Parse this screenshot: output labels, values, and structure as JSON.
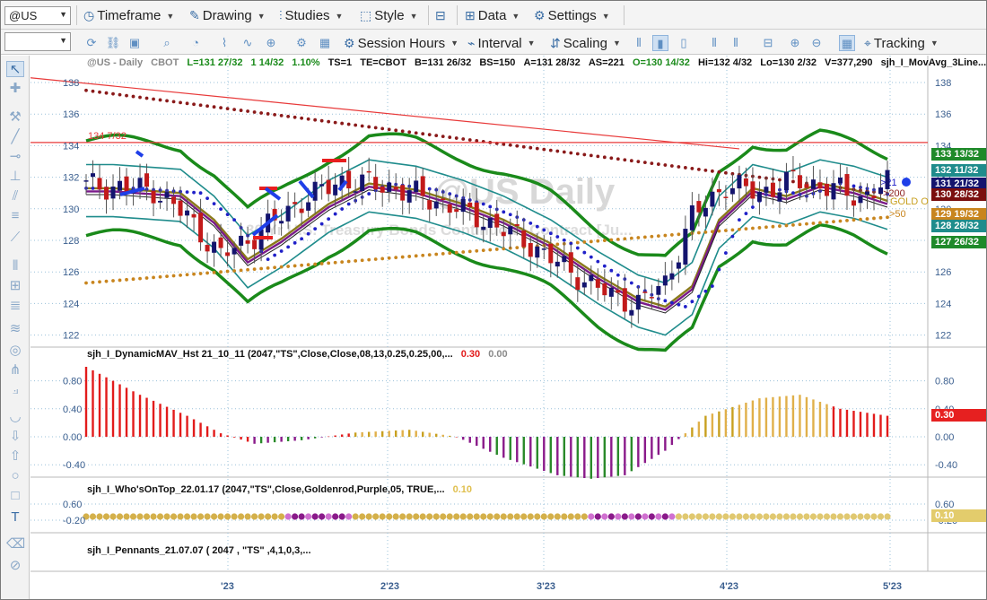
{
  "toolbar_top": {
    "symbol": "@US",
    "timeframe": "Timeframe",
    "drawing": "Drawing",
    "studies": "Studies",
    "style": "Style",
    "data": "Data",
    "settings": "Settings"
  },
  "toolbar_second": {
    "session_hours": "Session Hours",
    "interval": "Interval",
    "scaling": "Scaling",
    "tracking": "Tracking"
  },
  "price_header": {
    "symbol_label": "@US - Daily",
    "exchange": "CBOT",
    "last": "L=131 27/32",
    "change": "1 14/32",
    "pct": "1.10%",
    "ts": "TS=1",
    "te": "TE=CBOT",
    "bid": "B=131 26/32",
    "bs": "BS=150",
    "ask": "A=131 28/32",
    "as": "AS=221",
    "open": "O=130 14/32",
    "high": "Hi=132 4/32",
    "low": "Lo=130 2/32",
    "volume": "V=377,290",
    "study": "sjh_I_MovAvg_3Line..."
  },
  "watermark": {
    "main": "@US Daily",
    "sub": "30 Yr U.S. Treasury Bonds Continuous Contract [Ju..."
  },
  "horizontal_line_label": "134 7/32",
  "price_axis": [
    "138",
    "136",
    "134",
    "132",
    "130",
    "128",
    "126",
    "124",
    "122"
  ],
  "price_tags": [
    {
      "text": "133 13/32",
      "color": "#1f8a2a"
    },
    {
      "text": "132 11/32",
      "color": "#1f8c8c"
    },
    {
      "text": "131 21/32",
      "color": "#14146e"
    },
    {
      "text": "130 28/32",
      "color": "#7a0f0f"
    },
    {
      "text": "129 19/32",
      "color": "#c8851e"
    },
    {
      "text": "128 28/32",
      "color": "#1f8c8c"
    },
    {
      "text": "127 26/32",
      "color": "#1f8a2a"
    }
  ],
  "ma_labels": {
    "l21": ">21",
    "l200": ">200",
    "gold": "GOLD O",
    "l50": ">50"
  },
  "subpanel1": {
    "title": "sjh_I_DynamicMAV_Hst 21_10_11 (2047,\"TS\",Close,Close,08,13,0.25,0.25,00,...",
    "v1": "0.30",
    "v2": "0.00",
    "axis": [
      "0.80",
      "0.40",
      "0.00",
      "-0.40"
    ],
    "tag": "0.30"
  },
  "subpanel2": {
    "title": "sjh_I_Who'sOnTop_22.01.17 (2047,\"TS\",Close,Goldenrod,Purple,05, TRUE,...",
    "v1": "0.10",
    "axis": [
      "0.60",
      "-0.20"
    ],
    "tag": "0.10"
  },
  "subpanel3": {
    "title": "sjh_I_Pennants_21.07.07 ( 2047 , \"TS\" ,4,1,0,3,..."
  },
  "time_axis": [
    "'23",
    "2'23",
    "3'23",
    "4'23",
    "5'23"
  ],
  "colors": {
    "up_bar": "#14146e",
    "down_bar": "#c21a1a",
    "outer_band": "#1a8a1a",
    "inner_band": "#1f8c8c",
    "ma_gold": "#8a7a1a",
    "ma_purple": "#7a1a8a",
    "hist_red": "#e21b1b",
    "hist_gold": "#e0b04a",
    "hist_purple": "#8a1a8a",
    "hist_green": "#2a8a2a"
  }
}
